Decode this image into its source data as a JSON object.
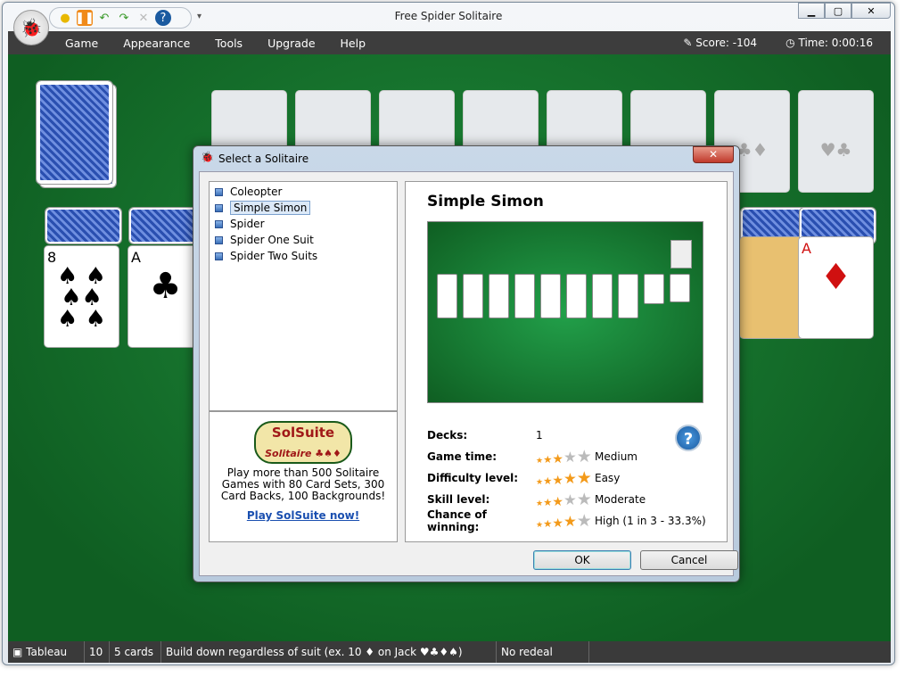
{
  "window": {
    "title": "Free Spider Solitaire"
  },
  "toolbar": {
    "icons": [
      "sun-icon",
      "pause-icon",
      "undo-icon",
      "redo-icon",
      "hint-icon",
      "help-icon"
    ]
  },
  "menu": [
    "Game",
    "Appearance",
    "Tools",
    "Upgrade",
    "Help"
  ],
  "score": {
    "label": "Score:",
    "value": "-104"
  },
  "time": {
    "label": "Time:",
    "value": "0:00:16"
  },
  "statusbar": {
    "mode": "Tableau",
    "count": "10",
    "cards": "5 cards",
    "rule": "Build down regardless of suit (ex. 10 ♦ on Jack ♥♣♦♠)",
    "redeal": "No redeal"
  },
  "dialog": {
    "title": "Select a Solitaire",
    "games": [
      "Coleopter",
      "Simple Simon",
      "Spider",
      "Spider One Suit",
      "Spider Two Suits"
    ],
    "selected": 1,
    "ad": {
      "logo": "SolSuite Solitaire",
      "text": "Play more than 500 Solitaire Games with 80 Card Sets, 300 Card Backs, 100 Backgrounds!",
      "link": "Play SolSuite now!"
    },
    "detail": {
      "name": "Simple Simon",
      "decks_label": "Decks:",
      "decks": "1",
      "ratings": [
        {
          "label": "Game time:",
          "stars": 3,
          "value": "Medium"
        },
        {
          "label": "Difficulty level:",
          "stars": 5,
          "value": "Easy"
        },
        {
          "label": "Skill level:",
          "stars": 3,
          "value": "Moderate"
        },
        {
          "label": "Chance of winning:",
          "stars": 4,
          "value": "High (1 in 3  -  33.3%)"
        }
      ]
    },
    "ok": "OK",
    "cancel": "Cancel"
  },
  "cards": {
    "c1_rank": "8",
    "c2_rank": "A",
    "c9_rank": "A"
  }
}
